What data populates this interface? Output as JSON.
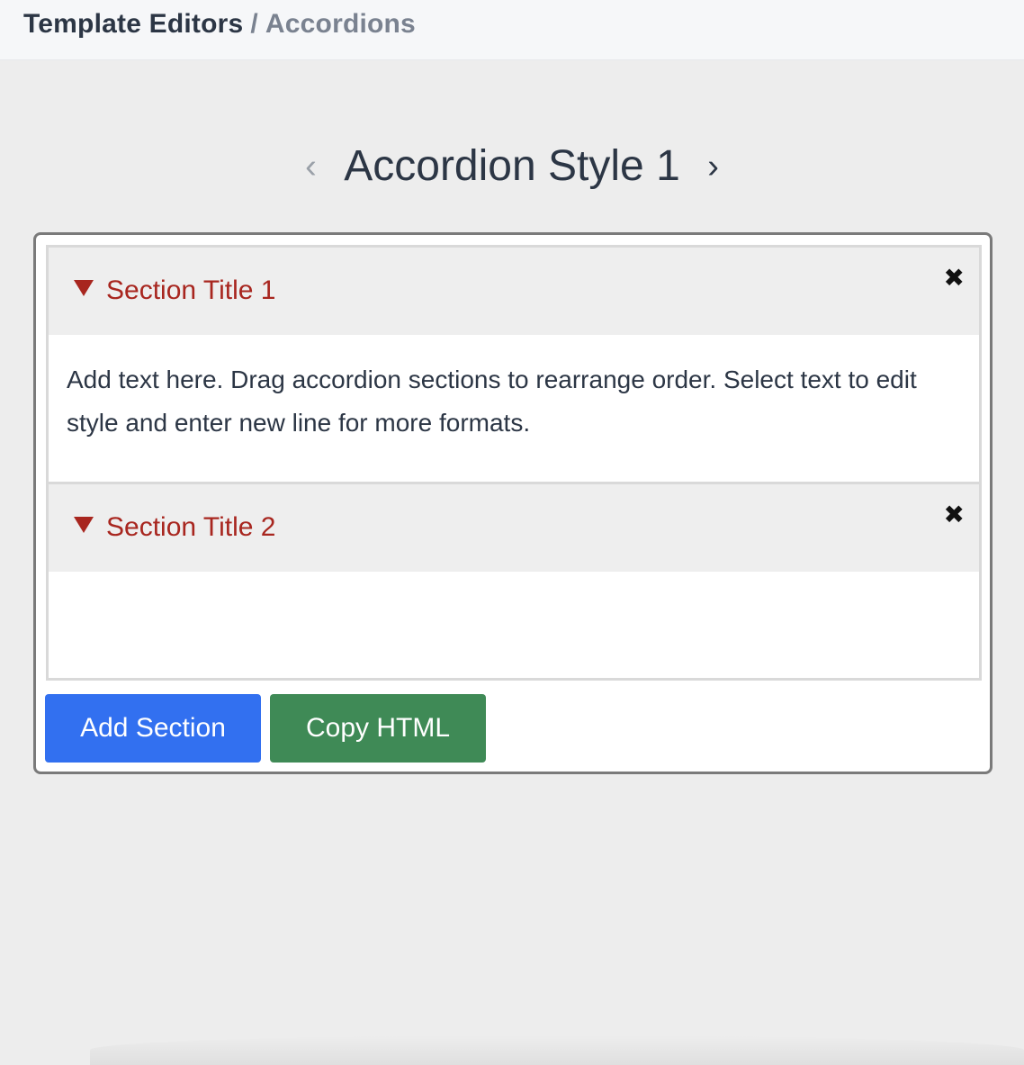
{
  "breadcrumb": {
    "root": "Template Editors",
    "separator": "/",
    "current": "Accordions"
  },
  "carousel": {
    "prev_icon": "chevron-left-icon",
    "next_icon": "chevron-right-icon",
    "prev_glyph": "‹",
    "next_glyph": "›",
    "title": "Accordion Style 1"
  },
  "accordion": {
    "sections": [
      {
        "title": "Section Title 1",
        "body": "Add text here. Drag accordion sections to rearrange order. Select text to edit style and enter new line for more formats.",
        "expanded": true
      },
      {
        "title": "Section Title 2",
        "body": "",
        "expanded": true
      }
    ],
    "close_glyph": "✖",
    "caret_icon": "caret-down-icon",
    "close_icon": "close-icon"
  },
  "actions": {
    "add_section_label": "Add Section",
    "copy_html_label": "Copy HTML"
  },
  "colors": {
    "title_text": "#2c3645",
    "section_title": "#a8261f",
    "add_button": "#3270f0",
    "copy_button": "#3f8a56",
    "background": "#ededed"
  }
}
